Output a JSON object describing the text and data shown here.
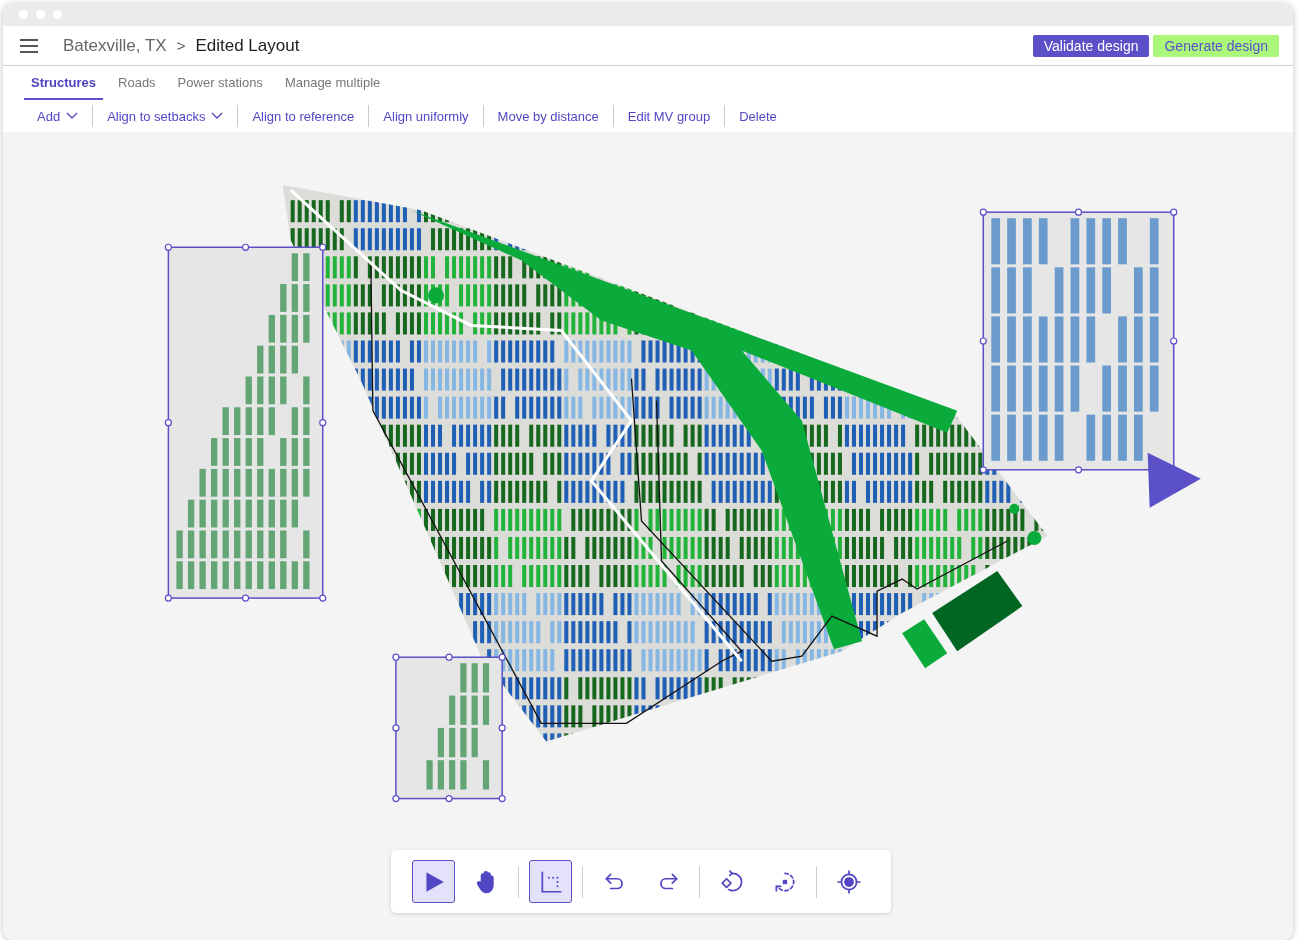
{
  "breadcrumb": {
    "parent": "Batexville, TX",
    "separator": ">",
    "current": "Edited Layout"
  },
  "buttons": [
    {
      "label": "Validate design",
      "kind": "primary"
    },
    {
      "label": "Generate design",
      "kind": "accent"
    }
  ],
  "tabs": [
    {
      "label": "Structures",
      "selected": true
    },
    {
      "label": "Roads",
      "selected": false
    },
    {
      "label": "Power stations",
      "selected": false
    },
    {
      "label": "Manage multiple",
      "selected": false
    }
  ],
  "actions": [
    {
      "label": "Add",
      "kind": "dropdown"
    },
    {
      "label": "Align to setbacks",
      "kind": "dropdown"
    },
    {
      "label": "Align to reference",
      "kind": "plain"
    },
    {
      "label": "Align uniformly",
      "kind": "plain"
    },
    {
      "label": "Move by distance",
      "kind": "plain"
    },
    {
      "label": "Edit MV group",
      "kind": "plain"
    },
    {
      "label": "Delete",
      "kind": "plain"
    }
  ],
  "tool_groups": [
    {
      "tools": [
        {
          "kind": "select",
          "selected": true
        },
        {
          "kind": "pan",
          "selected": false
        }
      ]
    },
    {
      "tools": [
        {
          "kind": "snap",
          "selected": true
        }
      ]
    },
    {
      "tools": [
        {
          "kind": "undo",
          "selected": false
        },
        {
          "kind": "redo",
          "selected": false
        }
      ]
    },
    {
      "tools": [
        {
          "kind": "rotate",
          "selected": false
        },
        {
          "kind": "rotate-center",
          "selected": false
        }
      ]
    },
    {
      "tools": [
        {
          "kind": "locate",
          "selected": false
        }
      ]
    }
  ]
}
